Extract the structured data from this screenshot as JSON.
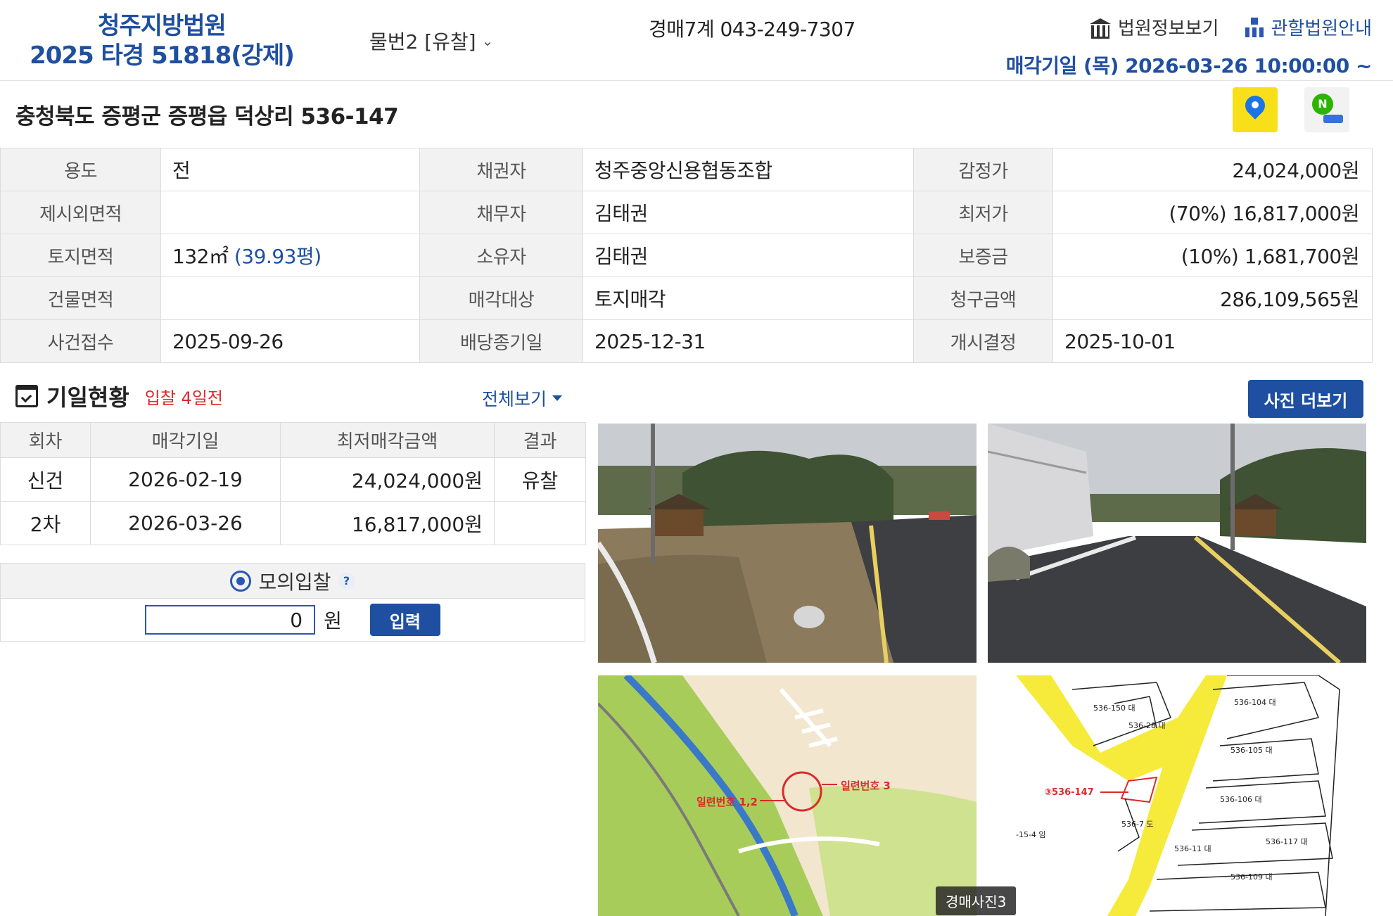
{
  "header": {
    "court": "청주지방법원",
    "case_no": "2025 타경 51818(강제)",
    "item_select": "물번2 [유찰]",
    "dept": "경매7계 043-249-7307",
    "link_court_info": "법원정보보기",
    "link_jurisdiction": "관할법원안내",
    "sale_date": "매각기일  (목) 2026-03-26 10:00:00 ~"
  },
  "address": "충청북도 증평군 증평읍 덕상리 536-147",
  "info": {
    "r1": {
      "l1": "용도",
      "v1": "전",
      "l2": "채권자",
      "v2": "청주중앙신용협동조합",
      "l3": "감정가",
      "v3": "24,024,000원"
    },
    "r2": {
      "l1": "제시외면적",
      "v1": "",
      "l2": "채무자",
      "v2": "김태권",
      "l3": "최저가",
      "v3": "(70%) 16,817,000원"
    },
    "r3": {
      "l1": "토지면적",
      "v1a": "132㎡",
      "v1b": "(39.93평)",
      "l2": "소유자",
      "v2": "김태권",
      "l3": "보증금",
      "v3": "(10%) 1,681,700원"
    },
    "r4": {
      "l1": "건물면적",
      "v1": "",
      "l2": "매각대상",
      "v2": "토지매각",
      "l3": "청구금액",
      "v3": "286,109,565원"
    },
    "r5": {
      "l1": "사건접수",
      "v1": "2025-09-26",
      "l2": "배당종기일",
      "v2": "2025-12-31",
      "l3": "개시결정",
      "v3": "2025-10-01"
    }
  },
  "schedule": {
    "title": "기일현황",
    "subtitle": "입찰 4일전",
    "view_all": "전체보기",
    "headers": [
      "회차",
      "매각기일",
      "최저매각금액",
      "결과"
    ],
    "rows": [
      [
        "신건",
        "2026-02-19",
        "24,024,000원",
        "유찰"
      ],
      [
        "2차",
        "2026-03-26",
        "16,817,000원",
        ""
      ]
    ]
  },
  "mock_bid": {
    "title": "모의입찰",
    "help": "?",
    "value": "0",
    "unit": "원",
    "button": "입력"
  },
  "photos": {
    "more_button": "사진 더보기",
    "tag": "경매사진3",
    "map_label_1": "일련번호 3",
    "map_label_2": "일련번호 1,2",
    "parcel_label": "③536-147",
    "parcels": [
      "536-150 대",
      "536-28 대",
      "536-104 대",
      "536-105 대",
      "536-106 대",
      "536-117 대",
      "536-11 대",
      "536-109 대",
      "536-7 도",
      "-15-4 임"
    ]
  },
  "colors": {
    "brand_blue": "#1f4fa0",
    "alert_red": "#d92b2b"
  }
}
